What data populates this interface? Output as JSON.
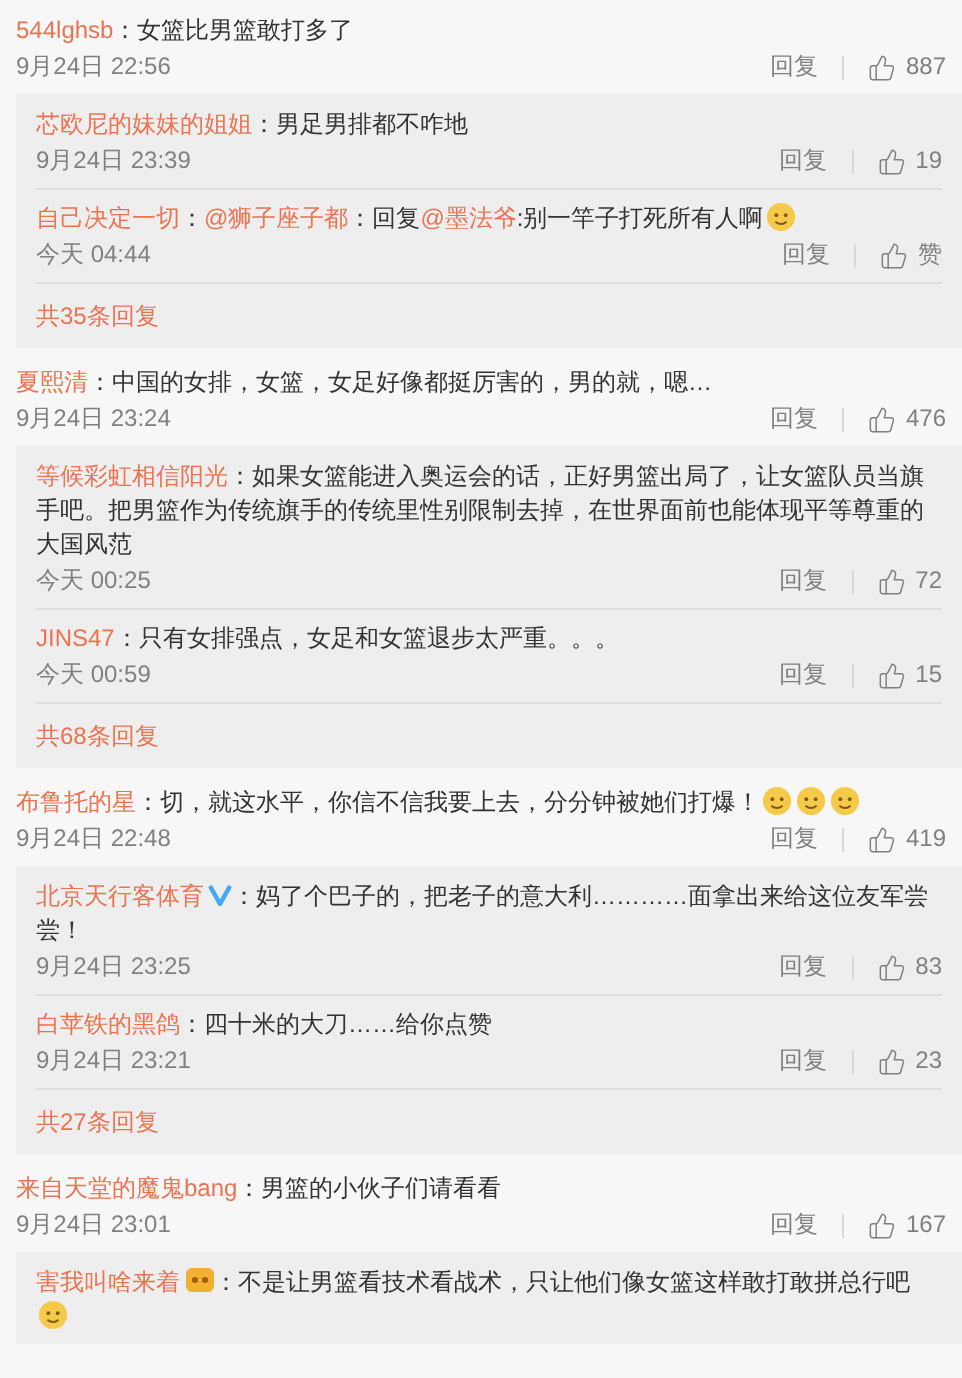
{
  "comments": [
    {
      "user": "544lghsb",
      "colon": "：",
      "segments": [
        {
          "kind": "plain",
          "text": "女篮比男篮敢打多了"
        }
      ],
      "time": "9月24日 22:56",
      "reply_label": "回复",
      "likes": "887",
      "replies": [
        {
          "user": "芯欧尼的妹妹的姐姐",
          "colon": "：",
          "segments": [
            {
              "kind": "plain",
              "text": "男足男排都不咋地"
            }
          ],
          "time": "9月24日 23:39",
          "reply_label": "回复",
          "likes": "19"
        },
        {
          "user": "自己决定一切",
          "colon": "：",
          "segments": [
            {
              "kind": "mention",
              "text": "@狮子座子都"
            },
            {
              "kind": "plain",
              "text": "：回复"
            },
            {
              "kind": "mention",
              "text": "@墨法爷"
            },
            {
              "kind": "plain",
              "text": ":别一竿子打死所有人啊"
            },
            {
              "kind": "emoji"
            }
          ],
          "time": "今天 04:44",
          "reply_label": "回复",
          "likes": "赞"
        }
      ],
      "more": "共35条回复"
    },
    {
      "user": "夏熙清",
      "colon": "：",
      "segments": [
        {
          "kind": "plain",
          "text": "中国的女排，女篮，女足好像都挺厉害的，男的就，嗯…"
        }
      ],
      "time": "9月24日 23:24",
      "reply_label": "回复",
      "likes": "476",
      "replies": [
        {
          "user": "等候彩虹相信阳光",
          "colon": "：",
          "segments": [
            {
              "kind": "plain",
              "text": "如果女篮能进入奥运会的话，正好男篮出局了，让女篮队员当旗手吧。把男篮作为传统旗手的传统里性别限制去掉，在世界面前也能体现平等尊重的大国风范"
            }
          ],
          "time": "今天 00:25",
          "reply_label": "回复",
          "likes": "72"
        },
        {
          "user": "JINS47",
          "colon": "：",
          "segments": [
            {
              "kind": "plain",
              "text": "只有女排强点，女足和女篮退步太严重。。。"
            }
          ],
          "time": "今天 00:59",
          "reply_label": "回复",
          "likes": "15"
        }
      ],
      "more": "共68条回复"
    },
    {
      "user": "布鲁托的星",
      "colon": "：",
      "segments": [
        {
          "kind": "plain",
          "text": "切，就这水平，你信不信我要上去，分分钟被她们打爆！"
        },
        {
          "kind": "emoji"
        },
        {
          "kind": "emoji"
        },
        {
          "kind": "emoji"
        }
      ],
      "time": "9月24日 22:48",
      "reply_label": "回复",
      "likes": "419",
      "replies": [
        {
          "user": "北京天行客体育",
          "verified": true,
          "colon": "：",
          "segments": [
            {
              "kind": "plain",
              "text": "妈了个巴子的，把老子的意大利…………面拿出来给这位友军尝尝！"
            }
          ],
          "time": "9月24日 23:25",
          "reply_label": "回复",
          "likes": "83"
        },
        {
          "user": "白苹铁的黑鸽",
          "colon": "：",
          "segments": [
            {
              "kind": "plain",
              "text": "四十米的大刀……给你点赞"
            }
          ],
          "time": "9月24日 23:21",
          "reply_label": "回复",
          "likes": "23"
        }
      ],
      "more": "共27条回复"
    },
    {
      "user": "来自天堂的魔鬼bang",
      "colon": "：",
      "segments": [
        {
          "kind": "plain",
          "text": "男篮的小伙子们请看看"
        }
      ],
      "time": "9月24日 23:01",
      "reply_label": "回复",
      "likes": "167",
      "replies": [
        {
          "user": "害我叫啥来着",
          "badge_icon": true,
          "colon": "：",
          "segments": [
            {
              "kind": "plain",
              "text": "不是让男篮看技术看战术，只让他们像女篮这样敢打敢拼总行吧"
            },
            {
              "kind": "emoji"
            }
          ]
        }
      ]
    }
  ]
}
